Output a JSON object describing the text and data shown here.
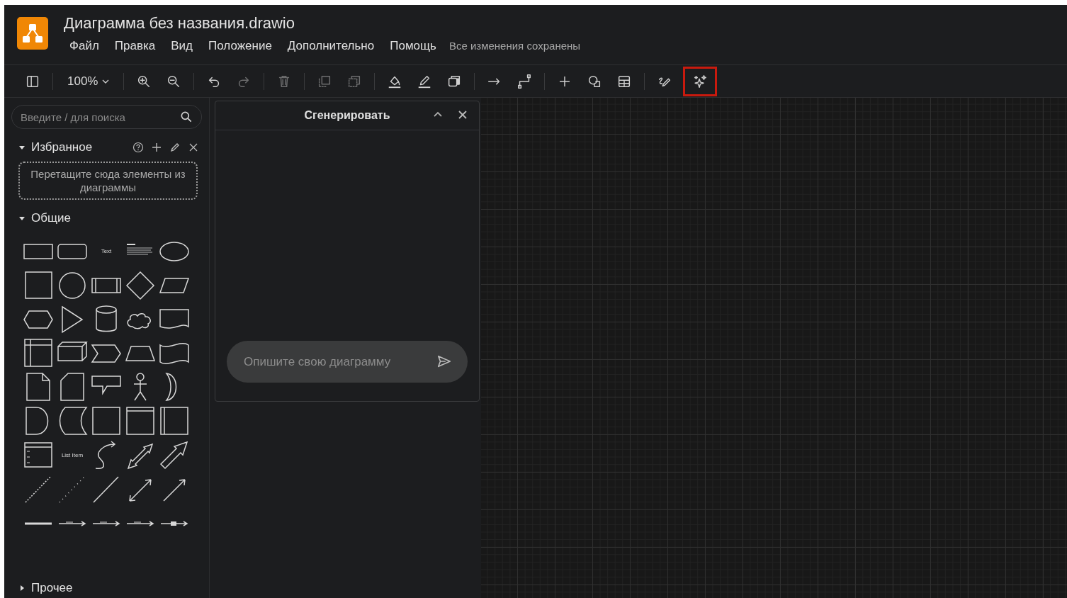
{
  "window": {
    "title": "Диаграмма без названия.drawio"
  },
  "menu": [
    {
      "label": "Файл"
    },
    {
      "label": "Правка"
    },
    {
      "label": "Вид"
    },
    {
      "label": "Положение"
    },
    {
      "label": "Дополнительно"
    },
    {
      "label": "Помощь"
    }
  ],
  "save_status": "Все изменения сохранены",
  "toolbar": [
    {
      "kind": "sidebar",
      "disabled": false,
      "highlighted": false
    },
    {
      "kind": "sep"
    },
    {
      "kind": "zoom",
      "label": "100%",
      "disabled": false,
      "highlighted": false
    },
    {
      "kind": "sep"
    },
    {
      "kind": "zoom-in",
      "disabled": false,
      "highlighted": false
    },
    {
      "kind": "zoom-out",
      "disabled": false,
      "highlighted": false
    },
    {
      "kind": "sep"
    },
    {
      "kind": "undo",
      "disabled": false,
      "highlighted": false
    },
    {
      "kind": "redo",
      "disabled": true,
      "highlighted": false
    },
    {
      "kind": "sep"
    },
    {
      "kind": "delete",
      "disabled": true,
      "highlighted": false
    },
    {
      "kind": "sep"
    },
    {
      "kind": "to-front",
      "disabled": true,
      "highlighted": false
    },
    {
      "kind": "to-back",
      "disabled": true,
      "highlighted": false
    },
    {
      "kind": "sep"
    },
    {
      "kind": "fill",
      "disabled": false,
      "highlighted": false
    },
    {
      "kind": "line-color",
      "disabled": false,
      "highlighted": false
    },
    {
      "kind": "shadow",
      "disabled": false,
      "highlighted": false
    },
    {
      "kind": "sep"
    },
    {
      "kind": "connector",
      "disabled": false,
      "highlighted": false
    },
    {
      "kind": "waypoint",
      "disabled": false,
      "highlighted": false
    },
    {
      "kind": "sep"
    },
    {
      "kind": "insert",
      "disabled": false,
      "highlighted": false
    },
    {
      "kind": "shapes",
      "disabled": false,
      "highlighted": false
    },
    {
      "kind": "table",
      "disabled": false,
      "highlighted": false
    },
    {
      "kind": "sep"
    },
    {
      "kind": "freehand",
      "disabled": false,
      "highlighted": false
    },
    {
      "kind": "sparkle",
      "disabled": false,
      "highlighted": true
    }
  ],
  "sidebar": {
    "search": {
      "placeholder": "Введите / для поиска"
    },
    "favorites": {
      "title": "Избранное",
      "expanded": true,
      "drop_hint": "Перетащите сюда элементы из диаграммы"
    },
    "general": {
      "title": "Общие",
      "expanded": true,
      "shapes": [
        {
          "kind": "rect"
        },
        {
          "kind": "rounded"
        },
        {
          "kind": "text",
          "label": "Text"
        },
        {
          "kind": "heading"
        },
        {
          "kind": "ellipse"
        },
        {
          "kind": "square"
        },
        {
          "kind": "circle"
        },
        {
          "kind": "process"
        },
        {
          "kind": "diamond"
        },
        {
          "kind": "parallelogram"
        },
        {
          "kind": "hexagon"
        },
        {
          "kind": "triangle"
        },
        {
          "kind": "cylinder"
        },
        {
          "kind": "cloud"
        },
        {
          "kind": "document"
        },
        {
          "kind": "internal-storage"
        },
        {
          "kind": "cube"
        },
        {
          "kind": "step"
        },
        {
          "kind": "trapezoid"
        },
        {
          "kind": "tape"
        },
        {
          "kind": "note"
        },
        {
          "kind": "card"
        },
        {
          "kind": "callout"
        },
        {
          "kind": "actor"
        },
        {
          "kind": "or"
        },
        {
          "kind": "delay"
        },
        {
          "kind": "data-storage"
        },
        {
          "kind": "container"
        },
        {
          "kind": "container-header"
        },
        {
          "kind": "container-side"
        },
        {
          "kind": "list"
        },
        {
          "kind": "list-item",
          "label": "List Item"
        },
        {
          "kind": "curve"
        },
        {
          "kind": "double-arrow"
        },
        {
          "kind": "bold-arrow"
        },
        {
          "kind": "dashed-line"
        },
        {
          "kind": "dotted-line"
        },
        {
          "kind": "line"
        },
        {
          "kind": "bidirectional"
        },
        {
          "kind": "arrow"
        },
        {
          "kind": "thick-line"
        },
        {
          "kind": "labeled-connector"
        },
        {
          "kind": "labeled-connector"
        },
        {
          "kind": "labeled-connector"
        },
        {
          "kind": "box-connector"
        }
      ]
    },
    "other": {
      "title": "Прочее",
      "expanded": false
    }
  },
  "generate_panel": {
    "title": "Сгенерировать",
    "input": {
      "placeholder": "Опишите свою диаграмму"
    }
  }
}
